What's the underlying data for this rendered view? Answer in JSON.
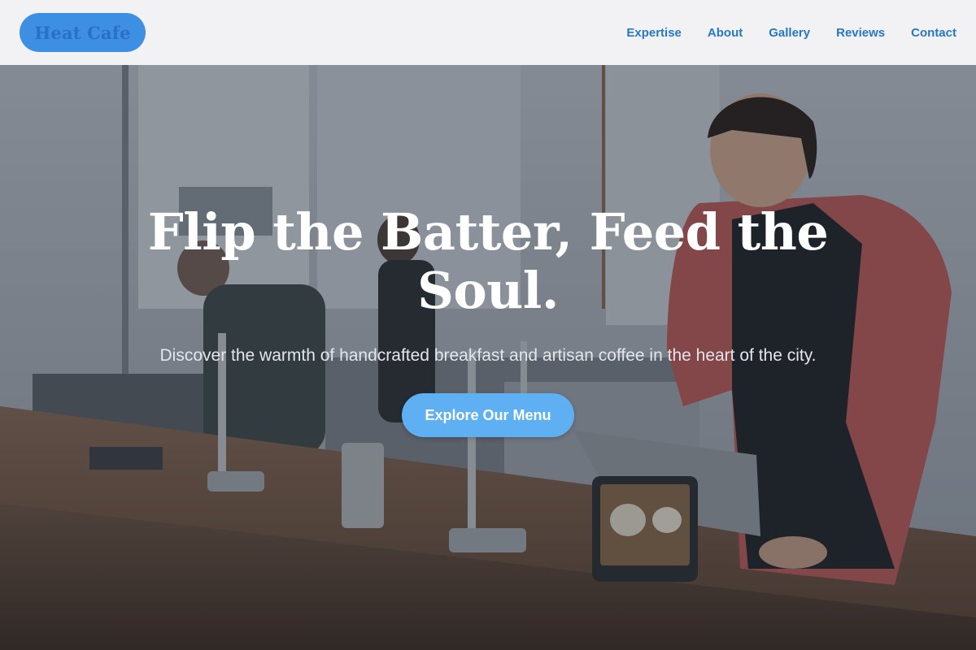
{
  "header": {
    "logo_text": "Heat Cafe",
    "nav_items": [
      {
        "label": "Expertise"
      },
      {
        "label": "About"
      },
      {
        "label": "Gallery"
      },
      {
        "label": "Reviews"
      },
      {
        "label": "Contact"
      }
    ]
  },
  "hero": {
    "title": "Flip the Batter, Feed the Soul.",
    "subtitle": "Discover the warmth of handcrafted breakfast and artisan coffee in the heart of the city.",
    "cta_label": "Explore Our Menu",
    "background_image": "cafe-barista-counter-photo"
  },
  "colors": {
    "header_bg": "#f6f6f7",
    "logo_bg": "#3d8fe3",
    "logo_text": "#2a6fc9",
    "nav_link": "#2677c4",
    "cta_bg": "#5fb0f2",
    "hero_text": "#ffffff"
  }
}
